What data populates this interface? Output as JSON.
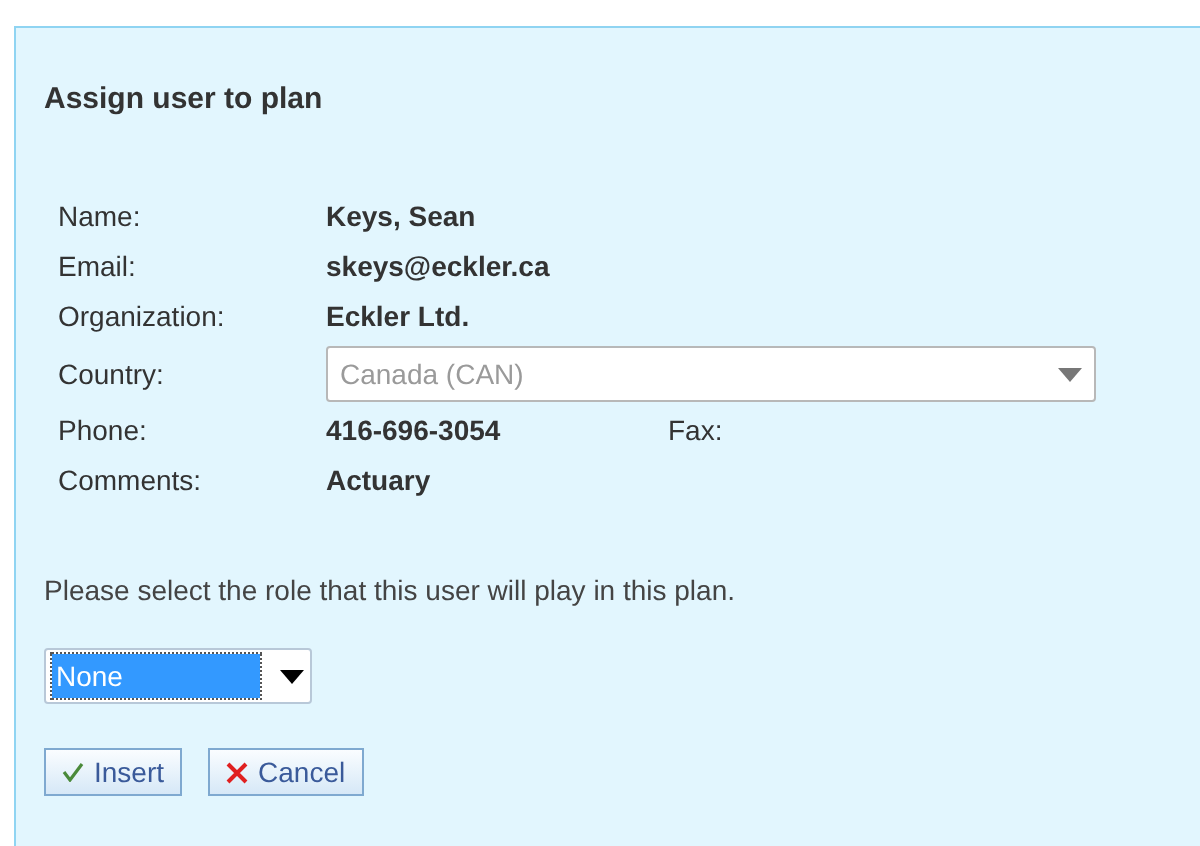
{
  "dialog": {
    "title": "Assign user to plan",
    "fields": [
      {
        "kind": "text",
        "label": "Name:",
        "value": "Keys, Sean"
      },
      {
        "kind": "text",
        "label": "Email:",
        "value": "skeys@eckler.ca"
      },
      {
        "kind": "text",
        "label": "Organization:",
        "value": "Eckler Ltd."
      },
      {
        "kind": "select",
        "label": "Country:",
        "value": "Canada (CAN)",
        "disabled": true
      },
      {
        "kind": "text",
        "label": "Phone:",
        "value": "416-696-3054",
        "extra_label": "Fax:"
      },
      {
        "kind": "text",
        "label": "Comments:",
        "value": "Actuary"
      }
    ],
    "instruction": "Please select the role that this user will play in this plan.",
    "role_select": {
      "value": "None",
      "focused": true
    },
    "buttons": [
      {
        "kind": "confirm",
        "label": "Insert"
      },
      {
        "kind": "cancel",
        "label": "Cancel"
      }
    ]
  }
}
